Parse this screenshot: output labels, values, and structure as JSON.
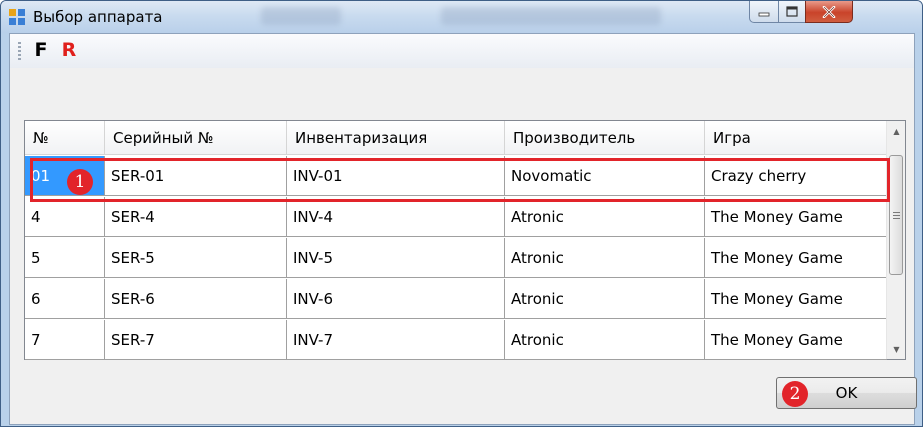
{
  "window": {
    "title": "Выбор аппарата"
  },
  "toolbar": {
    "f_label": "F",
    "r_label": "R"
  },
  "grid": {
    "columns": [
      "№",
      "Серийный №",
      "Инвентаризация",
      "Производитель",
      "Игра"
    ],
    "rows": [
      [
        "01",
        "SER-01",
        "INV-01",
        "Novomatic",
        "Crazy cherry"
      ],
      [
        "4",
        "SER-4",
        "INV-4",
        "Atronic",
        "The Money Game"
      ],
      [
        "5",
        "SER-5",
        "INV-5",
        "Atronic",
        "The Money Game"
      ],
      [
        "6",
        "SER-6",
        "INV-6",
        "Atronic",
        "The Money Game"
      ],
      [
        "7",
        "SER-7",
        "INV-7",
        "Atronic",
        "The Money Game"
      ]
    ],
    "selected_row": 0
  },
  "markers": {
    "m1": "1",
    "m2": "2"
  },
  "footer": {
    "ok_label": "OK"
  },
  "colors": {
    "selection": "#3399ff",
    "annotation": "#e2242a",
    "r_button": "#e0201c"
  }
}
